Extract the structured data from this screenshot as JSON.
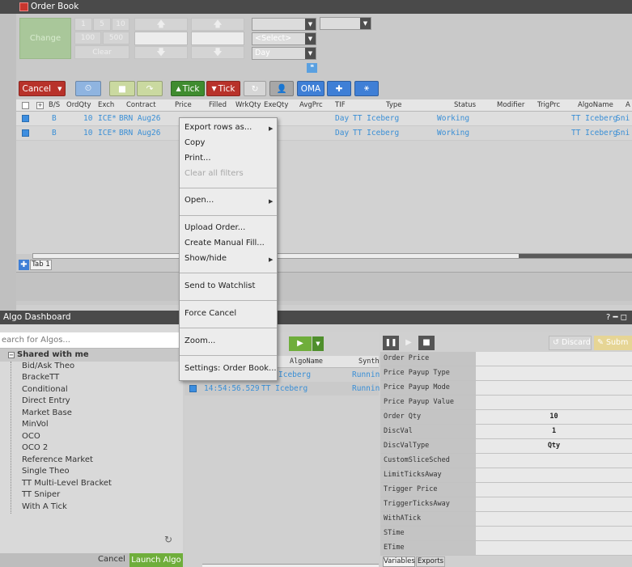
{
  "order_book": {
    "title": "Order Book",
    "change_label": "Change",
    "qty_buttons": [
      "1",
      "5",
      "10",
      "100",
      "500"
    ],
    "clear_label": "Clear",
    "select_placeholder": "<Select>",
    "tif_value": "Day",
    "toolbar": {
      "cancel": "Cancel",
      "tick_up": "Tick",
      "tick_down": "Tick",
      "oma": "OMA"
    },
    "columns": [
      "B/S",
      "OrdQty",
      "Exch",
      "Contract",
      "Price",
      "Filled",
      "WrkQty",
      "ExeQty",
      "AvgPrc",
      "TIF",
      "Type",
      "Status",
      "Modifier",
      "TrigPrc",
      "AlgoName",
      "A"
    ],
    "rows": [
      {
        "bs": "B",
        "qty": "10",
        "exch": "ICE*",
        "contract": "BRN Aug26",
        "tif": "Day",
        "type": "TT Iceberg",
        "status": "Working",
        "algo": "TT Iceberg",
        "extra": "Sni"
      },
      {
        "bs": "B",
        "qty": "10",
        "exch": "ICE*",
        "contract": "BRN Aug26",
        "tif": "Day",
        "type": "TT Iceberg",
        "status": "Working",
        "algo": "TT Iceberg",
        "extra": "Sni"
      }
    ],
    "tab_label": "Tab 1"
  },
  "context_menu": {
    "export": "Export rows as...",
    "copy": "Copy",
    "print": "Print...",
    "clear_filters": "Clear all filters",
    "open": "Open...",
    "upload": "Upload Order...",
    "manual_fill": "Create Manual Fill...",
    "show_hide": "Show/hide",
    "send_watchlist": "Send to Watchlist",
    "force_cancel": "Force Cancel",
    "zoom": "Zoom...",
    "settings": "Settings: Order Book..."
  },
  "algo_dashboard": {
    "title": "Algo Dashboard",
    "search_placeholder": "earch for Algos...",
    "tree_root": "Shared with me",
    "algos": [
      "Bid/Ask Theo",
      "BrackeTT",
      "Conditional",
      "Direct Entry",
      "Market Base",
      "MinVol",
      "OCO",
      "OCO 2",
      "Reference Market",
      "Single Theo",
      "TT Multi-Level Bracket",
      "TT Sniper",
      "With A Tick"
    ],
    "cancel": "Cancel",
    "launch": "Launch Algo",
    "mid_columns": [
      "AlgoName",
      "Synth"
    ],
    "mid_rows": [
      {
        "time": "",
        "algo": "Iceberg",
        "status": "Runnin"
      },
      {
        "time": "14:54:56.529",
        "algo": "TT Iceberg",
        "status": "Runnin"
      }
    ],
    "discard": "Discard",
    "submit": "Subm",
    "properties": [
      {
        "k": "Order Price",
        "v": ""
      },
      {
        "k": "Price Payup Type",
        "v": ""
      },
      {
        "k": "Price Payup Mode",
        "v": ""
      },
      {
        "k": "Price Payup Value",
        "v": ""
      },
      {
        "k": "Order Qty",
        "v": "10"
      },
      {
        "k": "DiscVal",
        "v": "1"
      },
      {
        "k": "DiscValType",
        "v": "Qty"
      },
      {
        "k": "CustomSliceSched",
        "v": ""
      },
      {
        "k": "LimitTicksAway",
        "v": ""
      },
      {
        "k": "Trigger Price",
        "v": ""
      },
      {
        "k": "TriggerTicksAway",
        "v": ""
      },
      {
        "k": "WithATick",
        "v": ""
      },
      {
        "k": "STime",
        "v": ""
      },
      {
        "k": "ETime",
        "v": ""
      }
    ],
    "tabs": [
      "Variables",
      "Exports"
    ],
    "controls": "? ━ ◻"
  },
  "colors": {
    "cancel": "#b8322a",
    "tick_up": "#3f8c2f",
    "tick_down": "#b8322a",
    "blue": "#3f7fd6",
    "green": "#6fae3b",
    "row_text": "#3a8fd6"
  }
}
